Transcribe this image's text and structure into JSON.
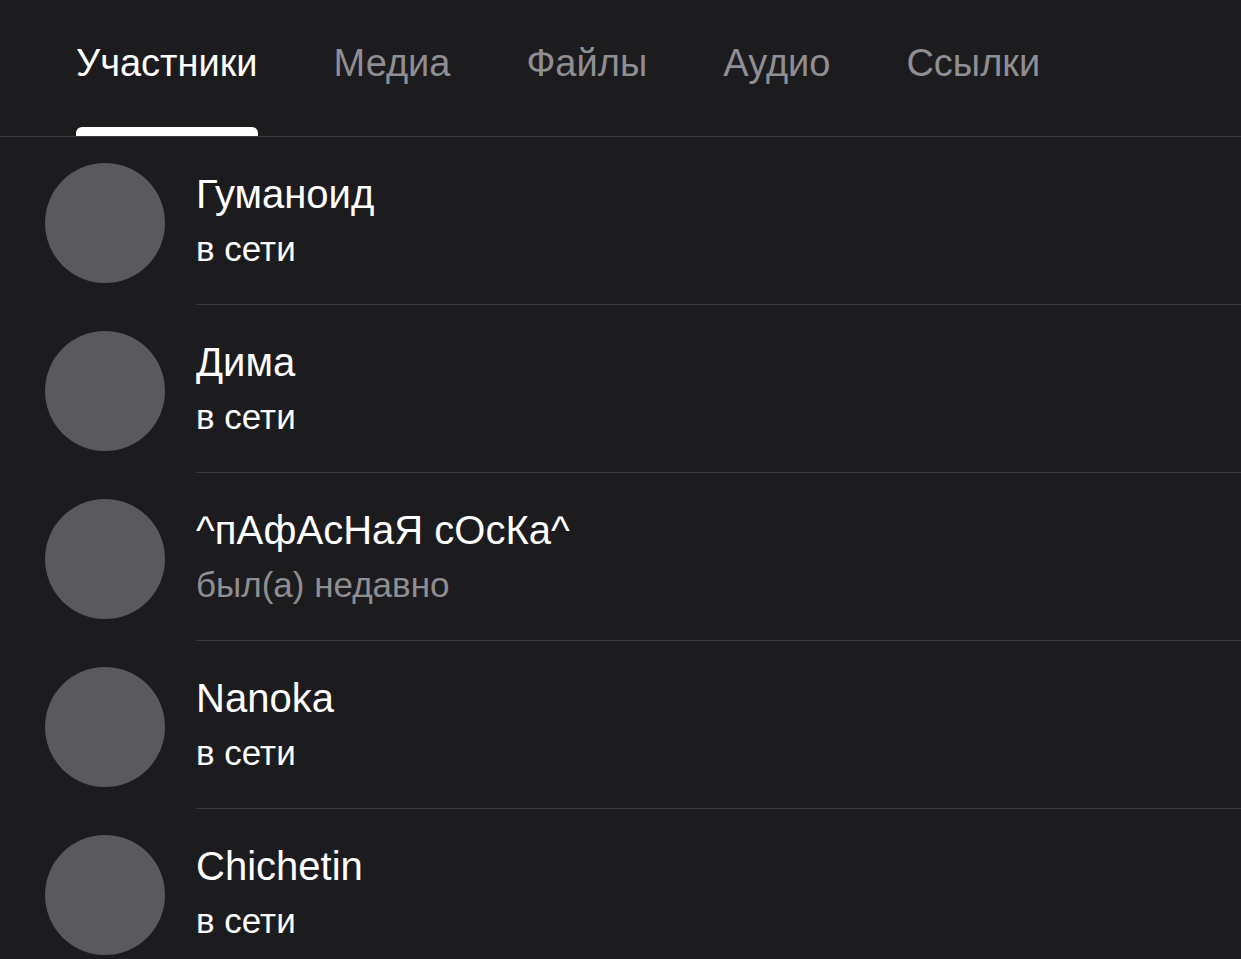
{
  "tabs": [
    {
      "label": "Участники",
      "selected": true
    },
    {
      "label": "Медиа",
      "selected": false
    },
    {
      "label": "Файлы",
      "selected": false
    },
    {
      "label": "Аудио",
      "selected": false
    },
    {
      "label": "Ссылки",
      "selected": false
    }
  ],
  "members": [
    {
      "name": "Гуманоид",
      "status": "в сети",
      "online": true
    },
    {
      "name": "Дима",
      "status": "в сети",
      "online": true
    },
    {
      "name": "^пАфАсНаЯ сОсКа^",
      "status": "был(а) недавно",
      "online": false
    },
    {
      "name": "Nanoka",
      "status": "в сети",
      "online": true
    },
    {
      "name": "Chichetin",
      "status": "в сети",
      "online": true
    }
  ]
}
